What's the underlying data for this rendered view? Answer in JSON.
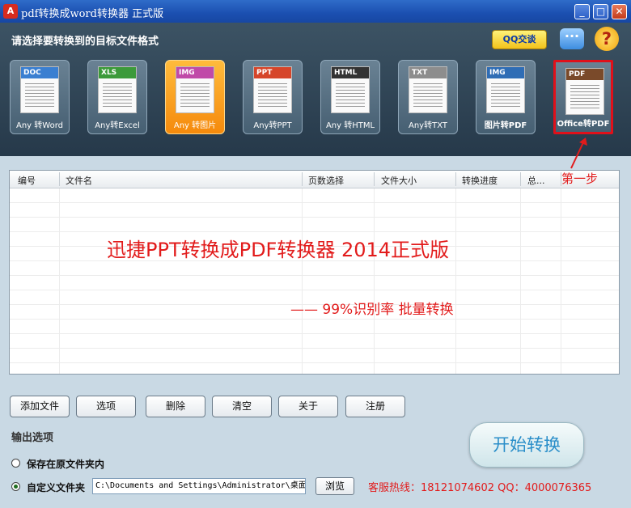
{
  "window": {
    "title": "pdf转换成word转换器 正式版",
    "app_icon_glyph": "A"
  },
  "header": {
    "prompt": "请选择要转换到的目标文件格式",
    "qq_button": "QQ交谈"
  },
  "formats": [
    {
      "tag": "DOC",
      "label": "Any 转Word",
      "band": "#3a7fd1"
    },
    {
      "tag": "XLS",
      "label": "Any转Excel",
      "band": "#3c9a3a"
    },
    {
      "tag": "IMG",
      "label": "Any 转图片",
      "band": "#c04aa8"
    },
    {
      "tag": "PPT",
      "label": "Any转PPT",
      "band": "#d6452a"
    },
    {
      "tag": "HTML",
      "label": "Any 转HTML",
      "band": "#333333"
    },
    {
      "tag": "TXT",
      "label": "Any转TXT",
      "band": "#8d8d8d"
    },
    {
      "tag": "IMG",
      "label": "图片转PDF",
      "band": "#2f6db5"
    },
    {
      "tag": "PDF",
      "label": "Office转PDF",
      "band": "#7a4a2a"
    }
  ],
  "step_label": "第一步",
  "table": {
    "columns": [
      "编号",
      "文件名",
      "页数选择",
      "文件大小",
      "转换进度",
      "总..."
    ]
  },
  "banner": {
    "line1": "迅捷PPT转换成PDF转换器 2014正式版",
    "line2": "—— 99%识别率  批量转换"
  },
  "buttons": {
    "add_file": "添加文件",
    "options": "选项",
    "delete": "删除",
    "clear": "清空",
    "about": "关于",
    "register": "注册",
    "start": "开始转换",
    "browse": "浏览"
  },
  "output": {
    "section_title": "输出选项",
    "option_original": "保存在原文件夹内",
    "option_custom": "自定义文件夹",
    "path": "C:\\Documents and Settings\\Administrator\\桌面"
  },
  "hotline": "客服热线：18121074602 QQ：4000076365",
  "colors": {
    "accent_red": "#e21b1b",
    "active_tile": "#f58a0c",
    "start_text": "#2a8ec9"
  }
}
